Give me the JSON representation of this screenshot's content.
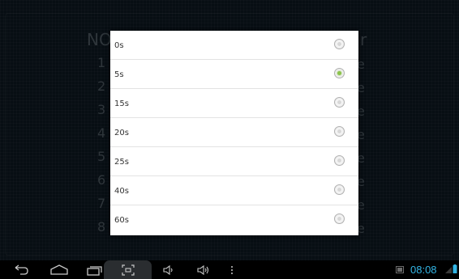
{
  "background": {
    "header_left": "NO",
    "header_right": "r",
    "row_numbers": [
      "1",
      "2",
      "3",
      "4",
      "5",
      "6",
      "7",
      "8"
    ],
    "row_suffix": "e"
  },
  "dialog": {
    "selected_index": 1,
    "options": [
      {
        "label": "0s",
        "selected": false
      },
      {
        "label": "5s",
        "selected": true
      },
      {
        "label": "15s",
        "selected": false
      },
      {
        "label": "20s",
        "selected": false
      },
      {
        "label": "25s",
        "selected": false
      },
      {
        "label": "40s",
        "selected": false
      },
      {
        "label": "60s",
        "selected": false
      }
    ]
  },
  "navbar": {
    "icons": [
      "back-icon",
      "home-icon",
      "recent-apps-icon",
      "screenshot-icon",
      "volume-down-icon",
      "volume-up-icon",
      "menu-icon"
    ],
    "clock": "08:08",
    "accent_color": "#33b5e5"
  },
  "colors": {
    "radio_selected": "#8bc34a"
  }
}
